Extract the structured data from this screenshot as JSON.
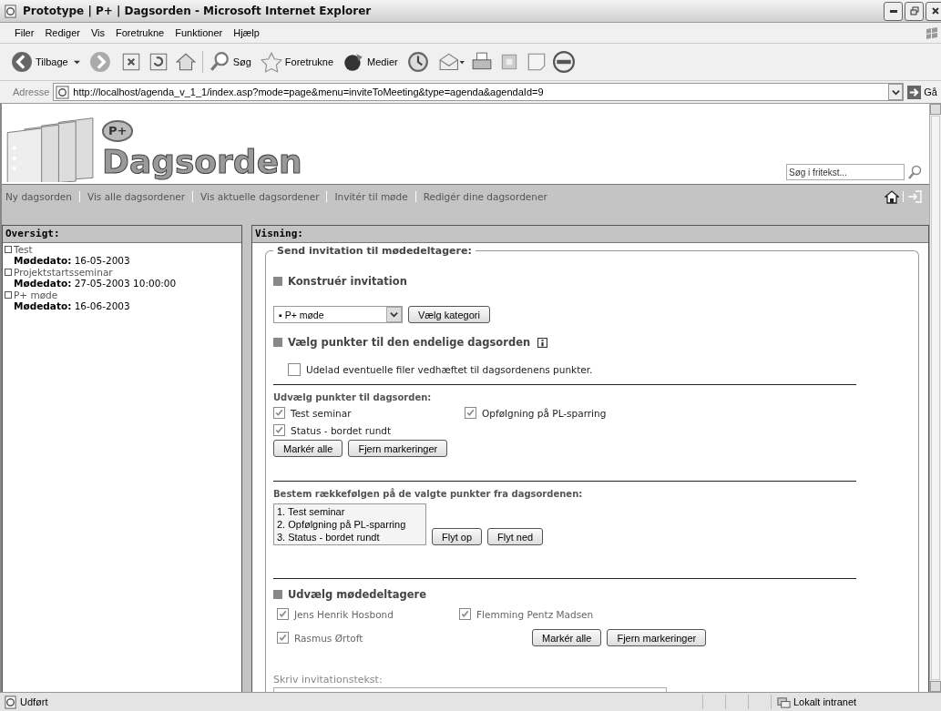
{
  "window": {
    "title": "Prototype | P+ | Dagsorden - Microsoft Internet Explorer"
  },
  "menu": [
    "Filer",
    "Rediger",
    "Vis",
    "Foretrukne",
    "Funktioner",
    "Hjælp"
  ],
  "toolbar": [
    {
      "kind": "back",
      "label": "Tilbage"
    },
    {
      "kind": "forward"
    },
    {
      "kind": "stop"
    },
    {
      "kind": "refresh"
    },
    {
      "kind": "home"
    },
    {
      "kind": "search",
      "label": "Søg"
    },
    {
      "kind": "favorites",
      "label": "Foretrukne"
    },
    {
      "kind": "media",
      "label": "Medier"
    },
    {
      "kind": "history"
    },
    {
      "kind": "mail"
    },
    {
      "kind": "print"
    },
    {
      "kind": "edit"
    },
    {
      "kind": "note"
    },
    {
      "kind": "messenger"
    }
  ],
  "address": {
    "label": "Adresse",
    "url": "http://localhost/agenda_v_1_1/index.asp?mode=page&menu=inviteToMeeting&type=agenda&agendaId=9",
    "go": "Gå"
  },
  "header": {
    "badge": "P+",
    "logo": "Dagsorden",
    "search": {
      "placeholder": "Søg i fritekst..."
    }
  },
  "nav": [
    "Ny dagsorden",
    "Vis alle dagsordener",
    "Vis aktuelle dagsordener",
    "Invitér til møde",
    "Redigér dine dagsordener"
  ],
  "sidebar": {
    "title": "Oversigt:",
    "items": [
      {
        "name": "Test",
        "date_label": "Mødedato:",
        "date": "16-05-2003"
      },
      {
        "name": "Projektstartsseminar",
        "date_label": "Mødedato:",
        "date": "27-05-2003 10:00:00"
      },
      {
        "name": "P+ møde",
        "date_label": "Mødedato:",
        "date": "16-06-2003"
      }
    ]
  },
  "main": {
    "title": "Visning:",
    "legend": "Send invitation til mødedeltagere:",
    "construct": {
      "heading": "Konstruér invitation",
      "category": "▪ P+ møde",
      "button": "Vælg kategori"
    },
    "select_points": {
      "heading": "Vælg punkter til den endelige dagsorden",
      "exclude": {
        "label": "Udelad eventuelle filer vedhæftet til dagsordenens punkter.",
        "checked": false
      },
      "points_label": "Udvælg punkter til dagsorden:",
      "points": [
        {
          "label": "Test seminar",
          "checked": true
        },
        {
          "label": "Opfølgning på PL-sparring",
          "checked": true
        },
        {
          "label": "Status - bordet rundt",
          "checked": true
        }
      ],
      "buttons": [
        "Markér alle",
        "Fjern markeringer"
      ],
      "order_label": "Bestem rækkefølgen på de valgte punkter fra dagsordenen:",
      "order": [
        "1. Test seminar",
        "2. Opfølgning på PL-sparring",
        "3. Status - bordet rundt"
      ],
      "order_buttons": [
        "Flyt op",
        "Flyt ned"
      ]
    },
    "participants": {
      "heading": "Udvælg mødedeltagere",
      "people": [
        {
          "name": "Jens Henrik Hosbond",
          "checked": true
        },
        {
          "name": "Flemming Pentz Madsen",
          "checked": true
        },
        {
          "name": "Rasmus Ørtoft",
          "checked": true
        }
      ],
      "buttons": [
        "Markér alle",
        "Fjern markeringer"
      ]
    },
    "text_label": "Skriv invitationstekst:"
  },
  "status_bar": {
    "text": "Udført",
    "zone": "Lokalt intranet"
  }
}
